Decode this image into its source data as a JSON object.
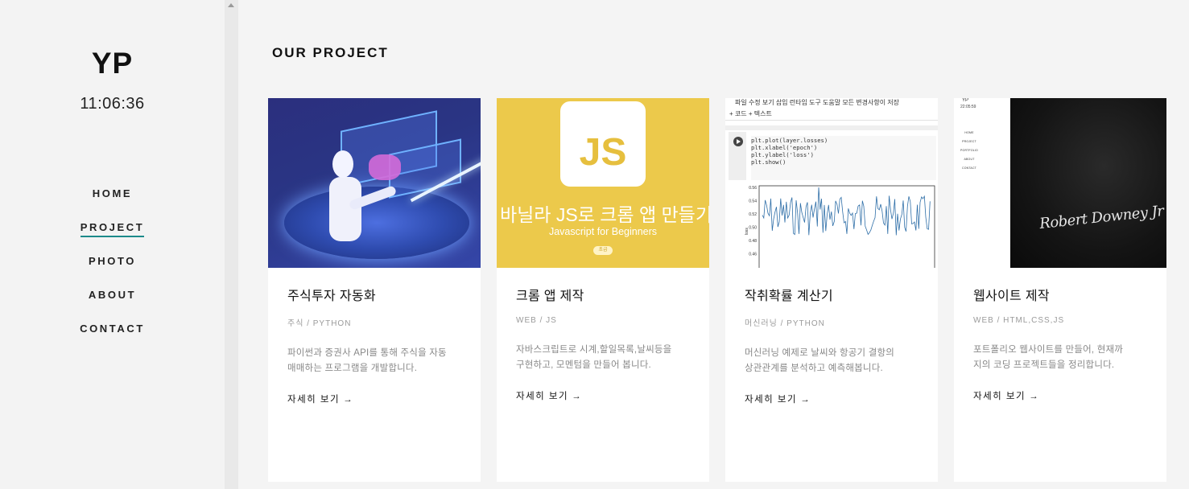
{
  "sidebar": {
    "logo": "YP",
    "clock": "11:06:36",
    "nav": [
      {
        "label": "HOME",
        "active": false
      },
      {
        "label": "PROJECT",
        "active": true
      },
      {
        "label": "PHOTO",
        "active": false
      },
      {
        "label": "ABOUT",
        "active": false
      },
      {
        "label": "CONTACT",
        "active": false
      }
    ]
  },
  "main": {
    "section_title": "OUR PROJECT",
    "projects": [
      {
        "title": "주식투자 자동화",
        "category": "주식",
        "tech": "PYTHON",
        "desc_line1": "파이썬과 증권사 API를 통해 주식을 자동",
        "desc_line2": "매매하는 프로그램을 개발합니다.",
        "more": "자세히 보기"
      },
      {
        "title": "크롬 앱 제작",
        "category": "WEB",
        "tech": "JS",
        "desc_line1": "자바스크립트로 시계,할일목록,날씨등을",
        "desc_line2": "구현하고, 모멘텀을 만들어 봅니다.",
        "more": "자세히 보기",
        "thumb": {
          "logo": "JS",
          "title_kr": "바닐라 JS로 크롬 앱 만들기",
          "subtitle": "Javascript for Beginners",
          "badge": "초급"
        }
      },
      {
        "title": "작취확률 계산기",
        "category": "머신러닝",
        "tech": "PYTHON",
        "desc_line1": "머신러닝 예제로 날씨와 항공기 결항의",
        "desc_line2": "상관관계를 분석하고 예측해봅니다.",
        "more": "자세히 보기",
        "thumb": {
          "menu": "파일  수정  보기  삽입  런타임  도구  도움말  모든 변경사항이 저장",
          "toolbar": "+ 코드    + 텍스트",
          "code": [
            "plt.plot(layer.losses)",
            "plt.xlabel('epoch')",
            "plt.ylabel('loss')",
            "plt.show()"
          ],
          "yticks": [
            "0.56",
            "0.54",
            "0.52",
            "0.50",
            "0.48",
            "0.46"
          ],
          "ylabel": "loss"
        }
      },
      {
        "title": "웹사이트 제작",
        "category": "WEB",
        "tech": "HTML,CSS,JS",
        "desc_line1": "포트폴리오 웹사이트를 만들어, 현재까",
        "desc_line2": "지의 코딩 프로젝트들을 정리합니다.",
        "more": "자세히 보기",
        "thumb": {
          "logo": "YP",
          "time": "22:05:59",
          "nav": [
            "HOME",
            "PROJECT",
            "PORTFOLIO",
            "ABOUT",
            "CONTACT"
          ],
          "signature": "Robert Downey Jr"
        }
      }
    ]
  },
  "colors": {
    "accent": "#1c8a8a",
    "js_yellow": "#ecc94b",
    "robot_bg": "#2b2f7e"
  },
  "separator": "/",
  "more_arrow": "→"
}
